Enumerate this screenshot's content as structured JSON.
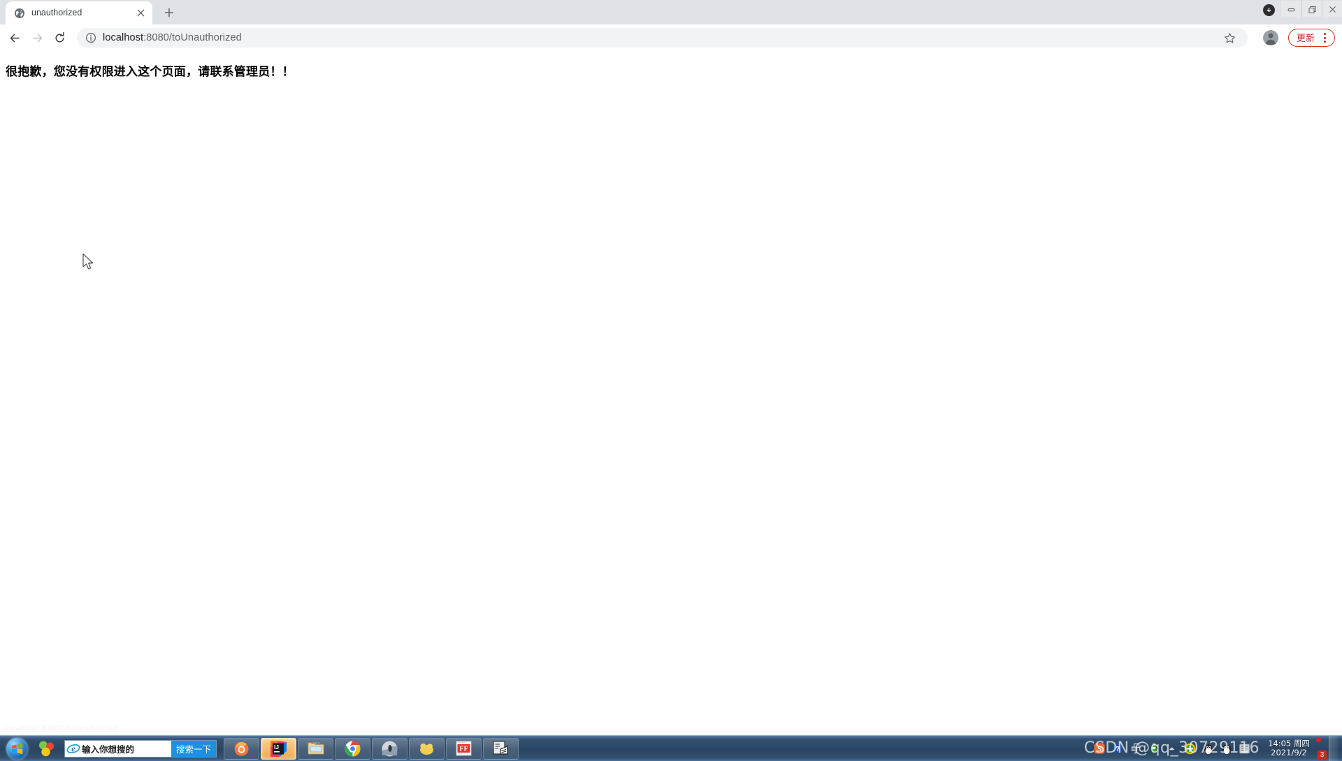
{
  "browser": {
    "tab": {
      "title": "unauthorized",
      "favicon": "globe-icon",
      "close": "×"
    },
    "new_tab_label": "+",
    "window_controls": {
      "minimize": "minimize-icon",
      "restore": "restore-icon",
      "close": "close-icon",
      "download": "download-icon"
    },
    "toolbar": {
      "back": "back-arrow-icon",
      "forward": "forward-arrow-icon",
      "reload": "reload-icon",
      "site_info": "info-circle-icon",
      "url_host": "localhost",
      "url_path": ":8080/toUnauthorized",
      "url_full": "localhost:8080/toUnauthorized",
      "bookmark": "star-icon",
      "profile": "avatar-icon",
      "update_label": "更新",
      "menu": "kebab-menu-icon"
    }
  },
  "page": {
    "message": "很抱歉，您没有权限进入这个页面，请联系管理员！！",
    "status_link": "localhost:8080/toUnauthorized"
  },
  "taskbar": {
    "start": "windows-start-orb",
    "sogou_icon": "sogou-icon",
    "search": {
      "engine_icon": "internet-explorer-icon",
      "placeholder": "输入你想搜的",
      "button_label": "搜索一下"
    },
    "apps": [
      {
        "name": "firefox",
        "label": "Firefox",
        "active": false
      },
      {
        "name": "intellij-idea",
        "label": "IntelliJ IDEA",
        "active": true
      },
      {
        "name": "file-explorer",
        "label": "资源管理器",
        "active": false
      },
      {
        "name": "google-chrome",
        "label": "Google Chrome",
        "active": false
      },
      {
        "name": "photo-viewer",
        "label": "图片查看器",
        "active": false
      },
      {
        "name": "yellow-app",
        "label": "应用",
        "active": false
      },
      {
        "name": "flashfxp",
        "label": "FlashFXP",
        "active": false
      },
      {
        "name": "editor-app",
        "label": "编辑器",
        "active": false
      }
    ],
    "tray": [
      {
        "name": "sogou-input-icon"
      },
      {
        "name": "help-icon"
      },
      {
        "name": "network-icon"
      },
      {
        "name": "usb-drive-icon"
      },
      {
        "name": "show-hidden-icons-icon"
      },
      {
        "name": "security-360-icon"
      },
      {
        "name": "qq-penguin-icon"
      },
      {
        "name": "qq-penguin-2-icon"
      }
    ],
    "clock": {
      "time": "14:05 周四",
      "date": "2021/9/2"
    },
    "badge_count": "3"
  },
  "watermark": {
    "text": "CSDN @qq_30729116"
  },
  "colors": {
    "tabstrip_bg": "#dee1e6",
    "omnibox_bg": "#f1f3f4",
    "update_red": "#d93025",
    "taskbar_blue": "#2c4765",
    "search_button_blue": "#1e90dd"
  }
}
